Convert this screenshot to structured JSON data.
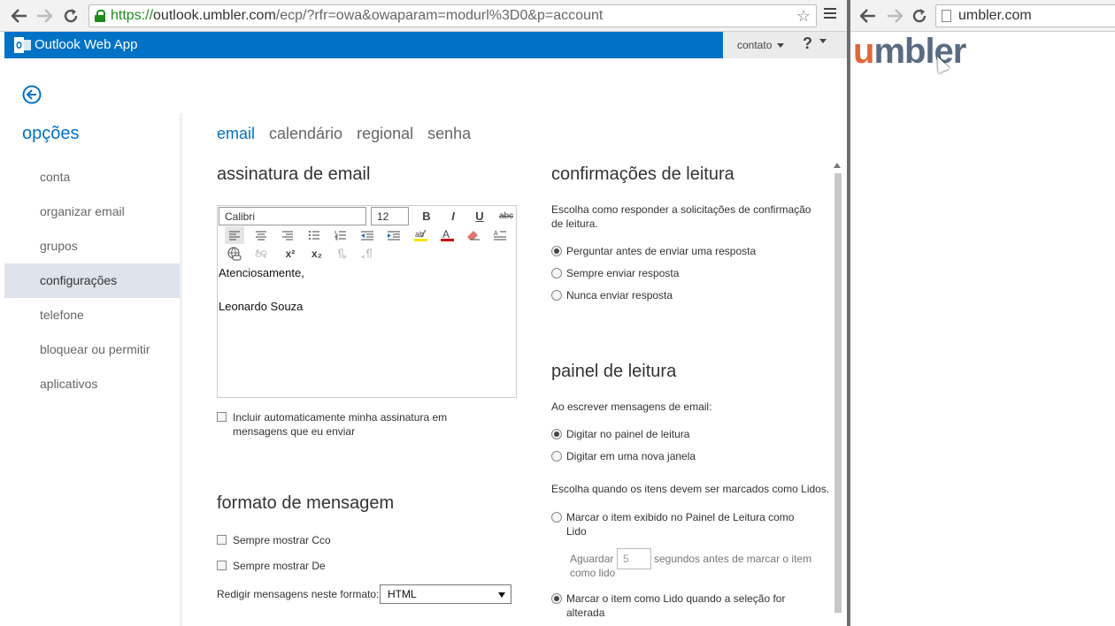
{
  "left_browser": {
    "url_secure": "https://",
    "url_host": "outlook.umbler.com",
    "url_rest": "/ecp/?rfr=owa&owaparam=modurl%3D0&p=account"
  },
  "app": {
    "title": "Outlook Web App",
    "brand_color": "#0072c6",
    "user_menu": "contato",
    "help_label": "?"
  },
  "sidebar": {
    "title": "opções",
    "items": [
      {
        "label": "conta"
      },
      {
        "label": "organizar email"
      },
      {
        "label": "grupos"
      },
      {
        "label": "configurações",
        "selected": true
      },
      {
        "label": "telefone"
      },
      {
        "label": "bloquear ou permitir"
      },
      {
        "label": "aplicativos"
      }
    ]
  },
  "tabs": [
    {
      "label": "email",
      "active": true
    },
    {
      "label": "calendário"
    },
    {
      "label": "regional"
    },
    {
      "label": "senha"
    }
  ],
  "signature": {
    "heading": "assinatura de email",
    "font": "Calibri",
    "size": "12",
    "toolbar": {
      "bold": "B",
      "italic": "I",
      "underline": "U",
      "strike": "abc",
      "superscript": "x²",
      "subscript": "x₂"
    },
    "body_line1": "Atenciosamente,",
    "body_line2": "Leonardo Souza",
    "auto_include": "Incluir automaticamente minha assinatura em mensagens que eu enviar"
  },
  "message_format": {
    "heading": "formato de mensagem",
    "show_bcc": "Sempre mostrar Cco",
    "show_from": "Sempre mostrar De",
    "compose_label": "Redigir mensagens neste formato:",
    "compose_value": "HTML"
  },
  "read_receipts": {
    "heading": "confirmações de leitura",
    "description": "Escolha como responder a solicitações de confirmação de leitura.",
    "options": [
      {
        "label": "Perguntar antes de enviar uma resposta",
        "checked": true
      },
      {
        "label": "Sempre enviar resposta"
      },
      {
        "label": "Nunca enviar resposta"
      }
    ]
  },
  "reading_pane": {
    "heading": "painel de leitura",
    "compose_description": "Ao escrever mensagens de email:",
    "compose_options": [
      {
        "label": "Digitar no painel de leitura",
        "checked": true
      },
      {
        "label": "Digitar em uma nova janela"
      }
    ],
    "mark_description": "Escolha quando os itens devem ser marcados como Lidos.",
    "mark_option1": "Marcar o item exibido no Painel de Leitura como Lido",
    "wait_before": "Aguardar",
    "wait_value": "5",
    "wait_after": "segundos antes de marcar o item como lido",
    "mark_option2": "Marcar o item como Lido quando a seleção for alterada"
  },
  "right_browser": {
    "url": "umbler.com",
    "logo_text_u": "u",
    "logo_text_rest": "mbler"
  }
}
